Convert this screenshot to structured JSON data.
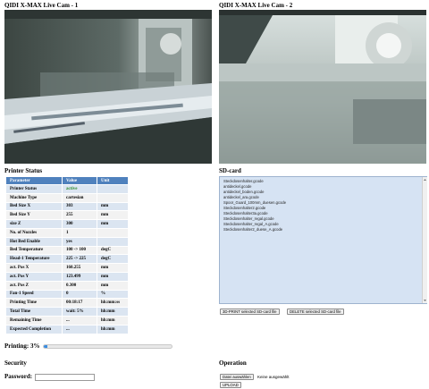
{
  "cameras": [
    {
      "title": "QIDI X-MAX Live Cam - 1"
    },
    {
      "title": "QIDI X-MAX Live Cam - 2"
    }
  ],
  "printer_status": {
    "title": "Printer Status",
    "headers": [
      "Parameter",
      "Value",
      "Unit"
    ],
    "rows": [
      [
        "Printer Status",
        "active",
        ""
      ],
      [
        "Machine Type",
        "cartesian",
        ""
      ],
      [
        "Bed Size X",
        "303",
        "mm"
      ],
      [
        "Bed Size Y",
        "255",
        "mm"
      ],
      [
        "size Z",
        "300",
        "mm"
      ],
      [
        "No. of Nozzles",
        "1",
        ""
      ],
      [
        "Hot Bed Enable",
        "yes",
        ""
      ],
      [
        "Bed Temperature",
        "100 -> 100",
        "degC"
      ],
      [
        "Head-1 Temperature",
        "225 -> 225",
        "degC"
      ],
      [
        "act. Pos X",
        "160.255",
        "mm"
      ],
      [
        "act. Pos Y",
        "123.499",
        "mm"
      ],
      [
        "act. Pos Z",
        "0.300",
        "mm"
      ],
      [
        "Fan-1 Speed",
        "0",
        "%"
      ],
      [
        "Printing Time",
        "00:18:17",
        "hh:mm:ss"
      ],
      [
        "Total Time",
        "wait: 5%",
        "hh:mm"
      ],
      [
        "Remaining Time",
        "...",
        "hh:mm"
      ],
      [
        "Expected Completion",
        "...",
        "hh:mm"
      ]
    ]
  },
  "sd_card": {
    "title": "SD-card",
    "files": [
      "Steckdosenhalter.gcode",
      "antideckel.gcode",
      "antideckel_boden.gcode",
      "antideckel_ara.gcode",
      "Spoor_Guard_100mm_duesen.gcode",
      "Steckdosenhalter2.gcode",
      "Steckdosenhalter3a.gcode",
      "Steckdosenhalter_regal.gcode",
      "Steckdosenhalter_regal_A.gcode",
      "Steckdosenhalter2_duese_A.gcode"
    ],
    "print_button": "3D-PRINT selected SD-card file",
    "delete_button": "DELETE selected SD-card file"
  },
  "progress": {
    "label": "Printing: 3%",
    "percent": 3,
    "color": "#3b8de0"
  },
  "security": {
    "title": "Security",
    "password_label": "Password:",
    "password_value": ""
  },
  "operation": {
    "title": "Operation",
    "choose_file_button": "Datei auswählen",
    "no_file_text": "Keine ausgewählt",
    "upload_button": "UPLOAD"
  },
  "colors": {
    "table_header": "#4f81bd",
    "row_odd": "#dbe5f1",
    "row_even": "#f2f2f2",
    "active_status": "#2e8b2e"
  }
}
